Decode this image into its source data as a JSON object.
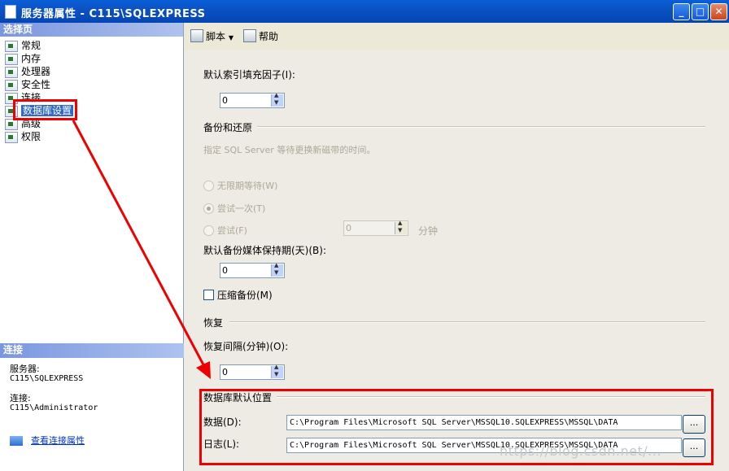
{
  "window": {
    "title": "服务器属性 - C115\\SQLEXPRESS",
    "min": "_",
    "max": "□",
    "close": "✕"
  },
  "left": {
    "select_page_header": "选择页",
    "pages": [
      {
        "label": "常规",
        "selected": false
      },
      {
        "label": "内存",
        "selected": false
      },
      {
        "label": "处理器",
        "selected": false
      },
      {
        "label": "安全性",
        "selected": false
      },
      {
        "label": "连接",
        "selected": false
      },
      {
        "label": "数据库设置",
        "selected": true
      },
      {
        "label": "高级",
        "selected": false
      },
      {
        "label": "权限",
        "selected": false
      }
    ],
    "connection_header": "连接",
    "server_label": "服务器:",
    "server_value": "C115\\SQLEXPRESS",
    "connection_label": "连接:",
    "connection_value": "C115\\Administrator",
    "view_link": "查看连接属性"
  },
  "toolbar": {
    "script": "脚本",
    "help": "帮助"
  },
  "form": {
    "index_fill_label": "默认索引填充因子(I):",
    "index_fill_value": "0",
    "backup_restore_header": "备份和还原",
    "backup_hint": "指定 SQL Server 等待更换新磁带的时间。",
    "radio_infinite": "无限期等待(W)",
    "radio_once": "尝试一次(T)",
    "radio_try": "尝试(F)",
    "try_value": "0",
    "minutes": "分钟",
    "retention_label": "默认备份媒体保持期(天)(B):",
    "retention_value": "0",
    "compress_label": "压缩备份(M)",
    "compress_checked": false,
    "recovery_header": "恢复",
    "recovery_interval_label": "恢复间隔(分钟)(O):",
    "recovery_interval_value": "0",
    "db_location_header": "数据库默认位置",
    "data_label": "数据(D):",
    "data_path": "C:\\Program Files\\Microsoft SQL Server\\MSSQL10.SQLEXPRESS\\MSSQL\\DATA",
    "log_label": "日志(L):",
    "log_path": "C:\\Program Files\\Microsoft SQL Server\\MSSQL10.SQLEXPRESS\\MSSQL\\DATA",
    "browse": "..."
  },
  "watermark": "https://blog.csdn.net/..."
}
